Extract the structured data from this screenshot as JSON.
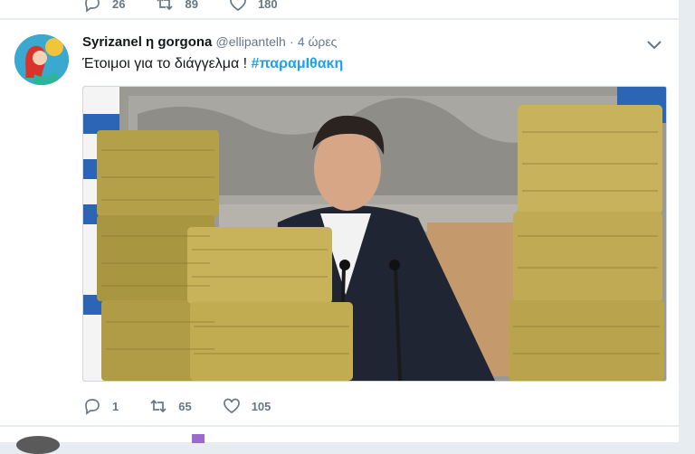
{
  "previous_tweet": {
    "reply_count": "26",
    "retweet_count": "89",
    "like_count": "180"
  },
  "tweet": {
    "display_name": "Syrizanel η gorgona",
    "handle": "@ellipantelh",
    "separator": "·",
    "time": "4 ώρες",
    "text": "Έτοιμοι για το διάγγελμα ! ",
    "hashtag": "#παραμΙθακη",
    "reply_count": "1",
    "retweet_count": "65",
    "like_count": "105"
  },
  "icons": {
    "reply": "reply-icon",
    "retweet": "retweet-icon",
    "like": "heart-icon",
    "caret": "chevron-down-icon"
  },
  "colors": {
    "accent": "#1da1f2",
    "muted": "#657786",
    "background": "#e6ecf0"
  }
}
